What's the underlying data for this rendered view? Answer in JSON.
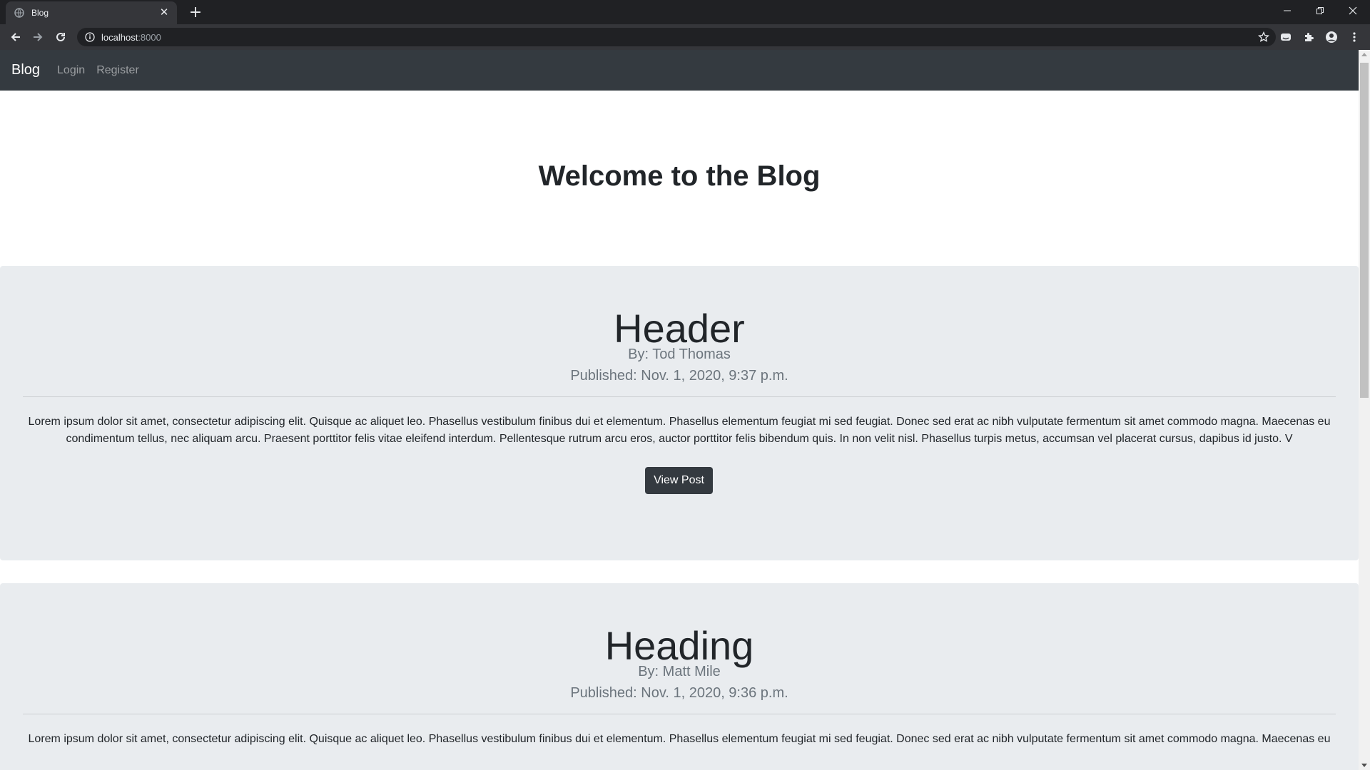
{
  "browser": {
    "tab_title": "Blog",
    "url_host": "localhost",
    "url_port": ":8000",
    "icons": [
      "page-favicon-icon",
      "tab-close-icon",
      "new-tab-icon",
      "minimize-icon",
      "restore-icon",
      "close-window-icon",
      "back-icon",
      "forward-icon",
      "reload-icon",
      "site-info-icon",
      "bookmark-star-icon",
      "extension-icon",
      "puzzle-extensions-icon",
      "profile-icon",
      "menu-kebab-icon"
    ]
  },
  "navbar": {
    "brand": "Blog",
    "links": [
      "Login",
      "Register"
    ]
  },
  "page": {
    "heading": "Welcome to the Blog"
  },
  "posts": [
    {
      "title": "Header",
      "author": "By: Tod Thomas",
      "published": "Published: Nov. 1, 2020, 9:37 p.m.",
      "excerpt": "Lorem ipsum dolor sit amet, consectetur adipiscing elit. Quisque ac aliquet leo. Phasellus vestibulum finibus dui et elementum. Phasellus elementum feugiat mi sed feugiat. Donec sed erat ac nibh vulputate fermentum sit amet commodo magna. Maecenas eu condimentum tellus, nec aliquam arcu. Praesent porttitor felis vitae eleifend interdum. Pellentesque rutrum arcu eros, auctor porttitor felis bibendum quis. In non velit nisl. Phasellus turpis metus, accumsan vel placerat cursus, dapibus id justo. V",
      "button": "View Post"
    },
    {
      "title": "Heading",
      "author": "By: Matt Mile",
      "published": "Published: Nov. 1, 2020, 9:36 p.m.",
      "excerpt": "Lorem ipsum dolor sit amet, consectetur adipiscing elit. Quisque ac aliquet leo. Phasellus vestibulum finibus dui et elementum. Phasellus elementum feugiat mi sed feugiat. Donec sed erat ac nibh vulputate fermentum sit amet commodo magna. Maecenas eu"
    }
  ],
  "colors": {
    "navbar_bg": "#343a40",
    "jumbotron_bg": "#e9ecef",
    "button_bg": "#343a40"
  }
}
